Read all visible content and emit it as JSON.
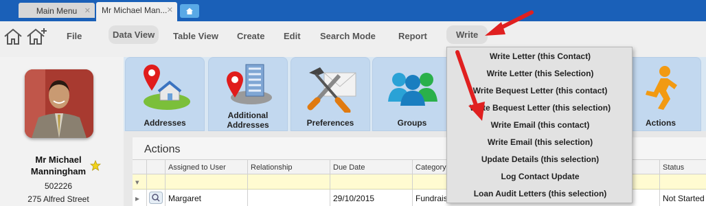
{
  "tabs": [
    {
      "label": "Main Menu",
      "close": "✕"
    },
    {
      "label": "Mr Michael Man...",
      "close": "✕"
    }
  ],
  "toolbar": {
    "file": "File",
    "data_view": "Data View",
    "table_view": "Table View",
    "create": "Create",
    "edit": "Edit",
    "search_mode": "Search  Mode",
    "report": "Report",
    "write": "Write"
  },
  "profile": {
    "name_line1": "Mr Michael",
    "name_line2": "Manningham",
    "id": "502226",
    "address": "275 Alfred Street"
  },
  "tiles": [
    {
      "label": "Addresses"
    },
    {
      "label_line1": "Additional",
      "label_line2": "Addresses"
    },
    {
      "label": "Preferences"
    },
    {
      "label": "Groups"
    },
    {
      "label": "Actions"
    }
  ],
  "panel": {
    "title": "Actions",
    "columns": [
      "Assigned to User",
      "Relationship",
      "Due Date",
      "Category",
      "Status"
    ],
    "filter_icon": "▾",
    "row_marker": "▸",
    "rows": [
      {
        "assigned": "Margaret",
        "relationship": "",
        "due": "29/10/2015",
        "category": "Fundrais",
        "status": "Not Started"
      }
    ]
  },
  "write_menu": {
    "items": [
      "Write Letter (this Contact)",
      "Write Letter (this Selection)",
      "Write Bequest Letter (this contact)",
      "Write Bequest Letter (this selection)",
      "Write Email (this contact)",
      "Write Email (this selection)",
      "Update Details (this selection)",
      "Log Contact Update",
      "Loan Audit Letters (this selection)"
    ]
  },
  "colors": {
    "tabbar": "#1a60b8",
    "tile": "#c2d8ef",
    "arrow": "#e02020",
    "filter_row": "#fffbd1"
  }
}
